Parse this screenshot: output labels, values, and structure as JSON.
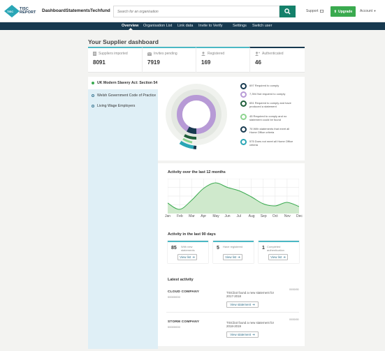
{
  "logo": {
    "line1": "TISC",
    "line2": "REPORT",
    "badge": "TISC"
  },
  "nav": [
    "Dashboard",
    "Statements",
    "Techfund"
  ],
  "search": {
    "placeholder": "Search for an organisation"
  },
  "header_right": {
    "support": "Support",
    "upgrade": "Upgrade",
    "account": "Account"
  },
  "subnav": [
    "Overview",
    "Organisation List",
    "Link data",
    "Invite to Verify",
    "Settings",
    "Switch user"
  ],
  "page_title": "Your Supplier dashboard",
  "stats": [
    {
      "label": "Suppliers imported",
      "value": "8091",
      "icon": "document-icon",
      "color": "#4bb8c4"
    },
    {
      "label": "Invites pending",
      "value": "7919",
      "icon": "envelope-icon",
      "color": "#4bb8c4"
    },
    {
      "label": "Registered",
      "value": "169",
      "icon": "user-icon",
      "color": "#4bb8c4"
    },
    {
      "label": "Authenticated",
      "value": "46",
      "icon": "user-plus-icon",
      "color": "#17394f"
    }
  ],
  "legislation": [
    {
      "label": "UK Modern Slavery Act: Section 54",
      "active": true
    },
    {
      "label": "Welsh Government Code of Practice",
      "active": false
    },
    {
      "label": "Living Wage Employers",
      "active": false
    }
  ],
  "legend": [
    {
      "text": "697 Required to comply",
      "color": "#17394f"
    },
    {
      "text": "7,394 Not required to comply",
      "color": "#b79ad6"
    },
    {
      "text": "651 Required to comply and have produced a statement",
      "color": "#1f5e3a"
    },
    {
      "text": "45 Required to comply and no statement could be found",
      "color": "#8dd48f"
    },
    {
      "text": "76 With statements that meet all Home Office criteria",
      "color": "#17394f"
    },
    {
      "text": "575 Does not meet all Home Office criteria",
      "color": "#2aa6b6"
    }
  ],
  "activity_title": "Activity over the last 12 months",
  "months": [
    "Jan",
    "Feb",
    "Mar",
    "Apr",
    "May",
    "Jun",
    "Jul",
    "Aug",
    "Sep",
    "Oct",
    "Nov",
    "Dec"
  ],
  "chart_data": {
    "type": "area",
    "title": "Activity over the last 12 months",
    "categories": [
      "Jan",
      "Feb",
      "Mar",
      "Apr",
      "May",
      "Jun",
      "Jul",
      "Aug",
      "Sep",
      "Oct",
      "Nov",
      "Dec"
    ],
    "values": [
      30,
      12,
      38,
      72,
      88,
      75,
      65,
      48,
      28,
      22,
      32,
      20
    ],
    "ylim": [
      0,
      100
    ],
    "grid": true,
    "color": "#3aaa4f"
  },
  "activity90_title": "Activity in the last 90 days",
  "activity90": [
    {
      "num": "85",
      "text": "With new statements",
      "button": "View list"
    },
    {
      "num": "5",
      "text": "Have registered",
      "button": "View list"
    },
    {
      "num": "1",
      "text": "Completed authentication",
      "button": "View list"
    }
  ],
  "latest_title": "Latest activity",
  "latest": [
    {
      "company": "CLOUD COMPANY",
      "number": "00000000",
      "message": "TISCbot found a new statement for 2017-2018",
      "date": "00/00/00",
      "button": "View statement"
    },
    {
      "company": "STORM COMPANY",
      "number": "00000000",
      "message": "TISCbot found a new statement for 2018-2019",
      "date": "00/00/00",
      "button": "View statement"
    }
  ]
}
